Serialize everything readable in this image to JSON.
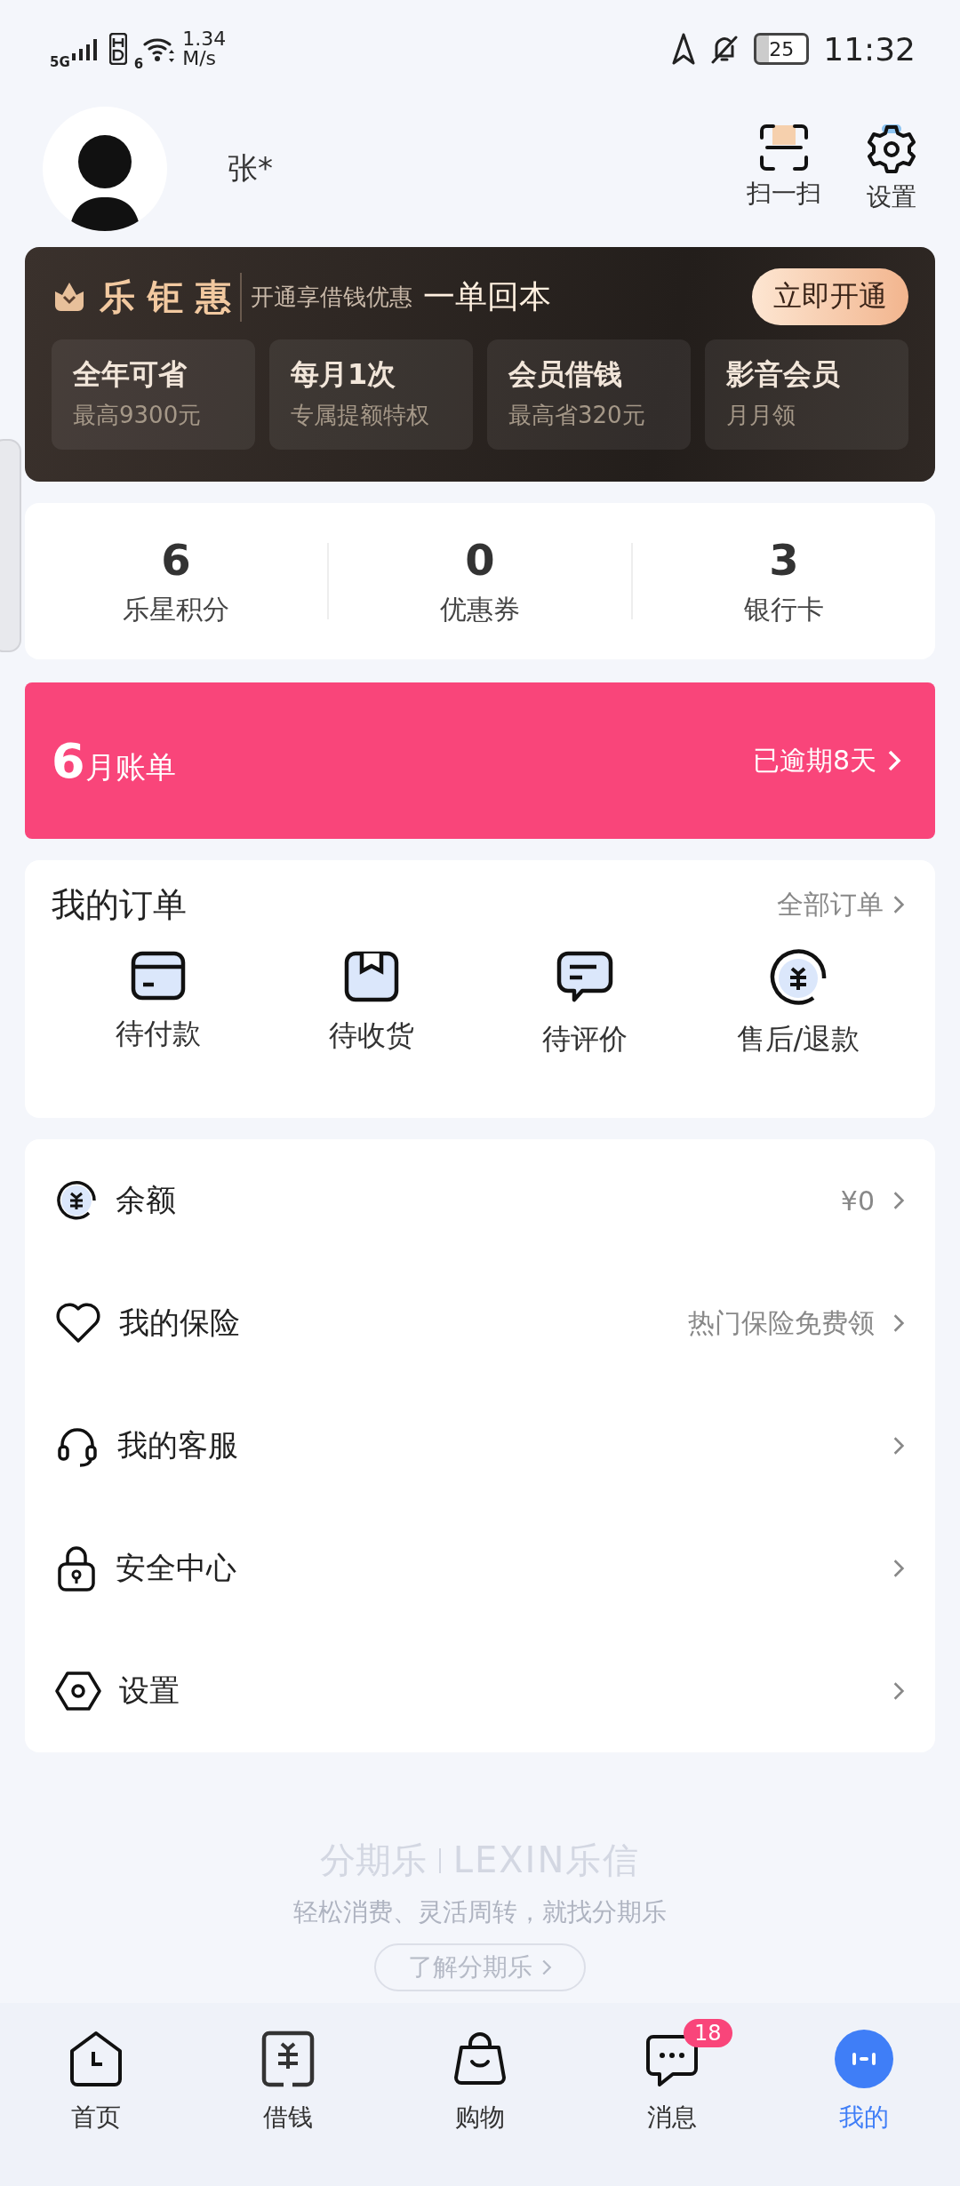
{
  "status_bar": {
    "network": "5G",
    "wifi_generation": "6",
    "speed": "1.34",
    "speed_unit": "M/s",
    "battery": "25",
    "time": "11:32"
  },
  "profile": {
    "name": "张*",
    "actions": [
      {
        "label": "扫一扫",
        "kind": "scan"
      },
      {
        "label": "设置",
        "kind": "settings"
      }
    ]
  },
  "membership": {
    "brand": "乐 钜 惠",
    "slogan": "开通享借钱优惠",
    "highlight": "一单回本",
    "button": "立即开通",
    "perks": [
      {
        "title": "全年可省",
        "subtitle": "最高9300元"
      },
      {
        "title": "每月1次",
        "subtitle": "专属提额特权"
      },
      {
        "title": "会员借钱",
        "subtitle": "最高省320元"
      },
      {
        "title": "影音会员",
        "subtitle": "月月领"
      }
    ]
  },
  "stats": [
    {
      "value": "6",
      "label": "乐星积分"
    },
    {
      "value": "0",
      "label": "优惠券"
    },
    {
      "value": "3",
      "label": "银行卡"
    }
  ],
  "bill": {
    "month": "6",
    "label": "月账单",
    "status": "已逾期8天"
  },
  "orders": {
    "title": "我的订单",
    "more": "全部订单",
    "items": [
      {
        "label": "待付款",
        "kind": "card"
      },
      {
        "label": "待收货",
        "kind": "box"
      },
      {
        "label": "待评价",
        "kind": "comment"
      },
      {
        "label": "售后/退款",
        "kind": "refund"
      }
    ]
  },
  "menu": [
    {
      "label": "余额",
      "value": "¥0",
      "kind": "balance"
    },
    {
      "label": "我的保险",
      "value": "热门保险免费领",
      "kind": "insurance"
    },
    {
      "label": "我的客服",
      "kind": "service"
    },
    {
      "label": "安全中心",
      "kind": "security"
    },
    {
      "label": "设置",
      "kind": "settings"
    }
  ],
  "footer": {
    "brand": "分期乐",
    "brand_en": "LEXIN乐信",
    "tagline": "轻松消费、灵活周转，就找分期乐",
    "button": "了解分期乐"
  },
  "nav": [
    {
      "label": "首页",
      "kind": "home",
      "selected": false
    },
    {
      "label": "借钱",
      "kind": "loan",
      "selected": false
    },
    {
      "label": "购物",
      "kind": "shop",
      "selected": false
    },
    {
      "label": "消息",
      "kind": "message",
      "selected": false,
      "badge": "18"
    },
    {
      "label": "我的",
      "kind": "me",
      "selected": true
    }
  ]
}
